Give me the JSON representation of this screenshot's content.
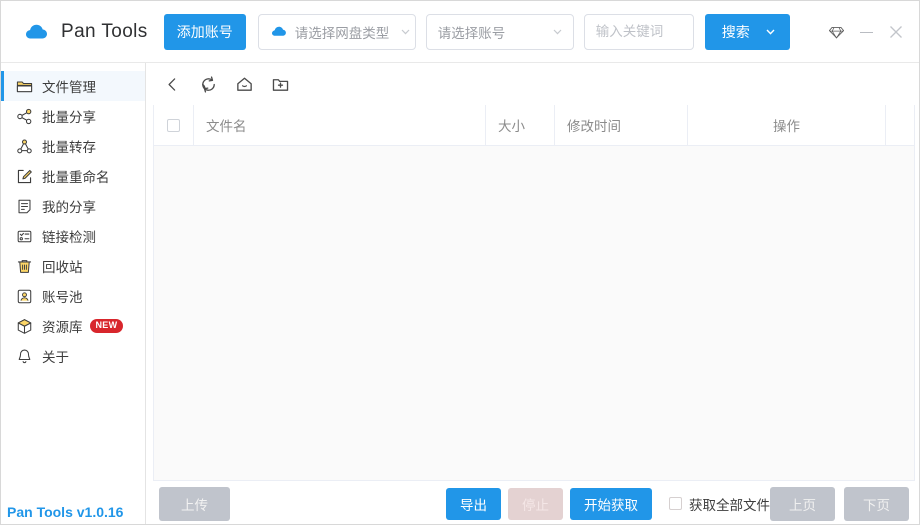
{
  "app": {
    "title": "Pan Tools",
    "version_label": "Pan Tools v1.0.16",
    "accent_blue": "#2196e8",
    "badge_red": "#d8262c",
    "disabled_gray": "#c0c4cc"
  },
  "topbar": {
    "logo_icon": "cloud-icon",
    "add_account_label": "添加账号",
    "pan_type_select": {
      "icon": "cloud-icon",
      "placeholder": "请选择网盘类型",
      "value": "",
      "chevron_icon": "chevron-down-icon"
    },
    "account_select": {
      "placeholder": "请选择账号",
      "value": "",
      "chevron_icon": "chevron-down-icon"
    },
    "keyword_input": {
      "placeholder": "输入关键词",
      "value": ""
    },
    "search_button": {
      "label": "搜索",
      "chevron_icon": "chevron-down-icon"
    },
    "window_controls": {
      "gem_icon": "diamond-icon",
      "minimize_icon": "minimize-icon",
      "close_icon": "close-icon"
    }
  },
  "sidebar": {
    "items": [
      {
        "label": "文件管理",
        "icon": "folder-icon",
        "active": true,
        "badge": ""
      },
      {
        "label": "批量分享",
        "icon": "share-nodes-icon",
        "active": false,
        "badge": ""
      },
      {
        "label": "批量转存",
        "icon": "transfer-icon",
        "active": false,
        "badge": ""
      },
      {
        "label": "批量重命名",
        "icon": "rename-edit-icon",
        "active": false,
        "badge": ""
      },
      {
        "label": "我的分享",
        "icon": "document-icon",
        "active": false,
        "badge": ""
      },
      {
        "label": "链接检测",
        "icon": "link-check-icon",
        "active": false,
        "badge": ""
      },
      {
        "label": "回收站",
        "icon": "trash-icon",
        "active": false,
        "badge": ""
      },
      {
        "label": "账号池",
        "icon": "account-pool-icon",
        "active": false,
        "badge": ""
      },
      {
        "label": "资源库",
        "icon": "box-icon",
        "active": false,
        "badge": "NEW"
      },
      {
        "label": "关于",
        "icon": "bell-icon",
        "active": false,
        "badge": ""
      }
    ]
  },
  "main": {
    "crumb_buttons": [
      {
        "name": "back-icon"
      },
      {
        "name": "refresh-icon"
      },
      {
        "name": "home-icon"
      },
      {
        "name": "new-folder-icon"
      }
    ],
    "table": {
      "select_all_checked": false,
      "columns": [
        {
          "key": "check",
          "label": ""
        },
        {
          "key": "name",
          "label": "文件名"
        },
        {
          "key": "size",
          "label": "大小"
        },
        {
          "key": "time",
          "label": "修改时间"
        },
        {
          "key": "op",
          "label": "操作"
        }
      ],
      "rows": []
    },
    "bottombar": {
      "upload_label": "上传",
      "export_label": "导出",
      "stop_label": "停止",
      "start_label": "开始获取",
      "fetch_all": {
        "label": "获取全部文件",
        "checked": false
      },
      "prev_page_label": "上页",
      "next_page_label": "下页"
    }
  }
}
